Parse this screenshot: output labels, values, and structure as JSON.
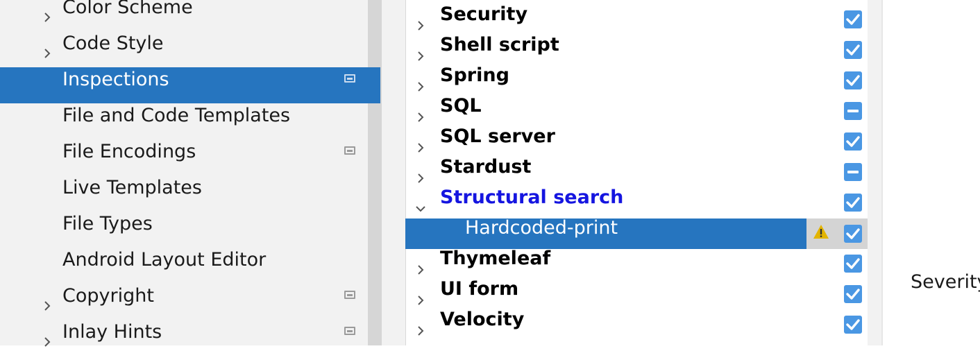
{
  "settings_tree": {
    "items": [
      {
        "label": "Color Scheme",
        "expandable": true,
        "project_icon": false,
        "selected": false
      },
      {
        "label": "Code Style",
        "expandable": true,
        "project_icon": false,
        "selected": false
      },
      {
        "label": "Inspections",
        "expandable": false,
        "project_icon": true,
        "selected": true
      },
      {
        "label": "File and Code Templates",
        "expandable": false,
        "project_icon": false,
        "selected": false
      },
      {
        "label": "File Encodings",
        "expandable": false,
        "project_icon": true,
        "selected": false
      },
      {
        "label": "Live Templates",
        "expandable": false,
        "project_icon": false,
        "selected": false
      },
      {
        "label": "File Types",
        "expandable": false,
        "project_icon": false,
        "selected": false
      },
      {
        "label": "Android Layout Editor",
        "expandable": false,
        "project_icon": false,
        "selected": false
      },
      {
        "label": "Copyright",
        "expandable": true,
        "project_icon": true,
        "selected": false
      },
      {
        "label": "Inlay Hints",
        "expandable": true,
        "project_icon": true,
        "selected": false
      }
    ]
  },
  "inspections_tree": {
    "rows": [
      {
        "label": "Security",
        "state": "checked",
        "expanded": false
      },
      {
        "label": "Shell script",
        "state": "checked",
        "expanded": false
      },
      {
        "label": "Spring",
        "state": "checked",
        "expanded": false
      },
      {
        "label": "SQL",
        "state": "partial",
        "expanded": false
      },
      {
        "label": "SQL server",
        "state": "checked",
        "expanded": false
      },
      {
        "label": "Stardust",
        "state": "partial",
        "expanded": false
      },
      {
        "label": "Structural search",
        "state": "checked",
        "expanded": true,
        "modified": true
      },
      {
        "label": "Hardcoded-print",
        "state": "checked",
        "child": true,
        "selected": true,
        "severity_icon": "warning-icon"
      },
      {
        "label": "Thymeleaf",
        "state": "checked",
        "expanded": false
      },
      {
        "label": "UI form",
        "state": "checked",
        "expanded": false
      },
      {
        "label": "Velocity",
        "state": "checked",
        "expanded": false
      }
    ]
  },
  "details": {
    "severity_label": "Severity"
  },
  "colors": {
    "selection": "#2675bf",
    "checkbox": "#4a97e3",
    "modified_text": "#1515e0",
    "warning": "#e3b400"
  }
}
